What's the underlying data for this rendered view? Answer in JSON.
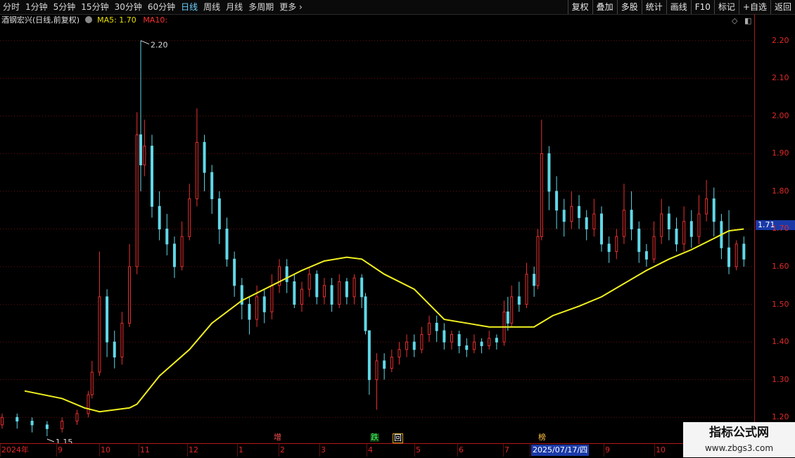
{
  "toolbar": {
    "periods": [
      "分时",
      "1分钟",
      "5分钟",
      "15分钟",
      "30分钟",
      "60分钟",
      "日线",
      "周线",
      "月线",
      "多周期",
      "更多"
    ],
    "active_period": "日线",
    "right_buttons": [
      "复权",
      "叠加",
      "多股",
      "统计",
      "画线",
      "F10",
      "标记",
      "+自选",
      "返回"
    ]
  },
  "info": {
    "stock": "酒钢宏兴(日线,前复权)",
    "ma5": "MA5: 1.70",
    "ma10": "MA10:"
  },
  "price_axis": {
    "labels": [
      "2.20",
      "2.10",
      "2.00",
      "1.90",
      "1.80",
      "1.70",
      "1.60",
      "1.50",
      "1.40",
      "1.30",
      "1.20"
    ],
    "current": "1.71"
  },
  "date_axis": {
    "labels": [
      "2024年",
      "9",
      "10",
      "11",
      "12",
      "1",
      "2",
      "3",
      "4",
      "5",
      "6",
      "7",
      "2025/07/17/四",
      "9",
      "10"
    ]
  },
  "markers": [
    "增",
    "跌",
    "回",
    "榜"
  ],
  "annotations": {
    "high": "2.20",
    "low": "1.15"
  },
  "watermark": {
    "line1": "指标公式网",
    "line2": "www.zbgs3.com"
  },
  "chart_data": {
    "type": "candlestick",
    "ylim": [
      1.15,
      2.22
    ],
    "grid": true,
    "colors": {
      "up": "#e83030",
      "down": "#60d8e8",
      "ma": "#f0f020",
      "grid": "#6a1010"
    },
    "ma_line": [
      [
        0.03,
        1.27
      ],
      [
        0.08,
        1.25
      ],
      [
        0.11,
        1.225
      ],
      [
        0.13,
        1.215
      ],
      [
        0.15,
        1.22
      ],
      [
        0.17,
        1.225
      ],
      [
        0.18,
        1.235
      ],
      [
        0.21,
        1.31
      ],
      [
        0.25,
        1.38
      ],
      [
        0.28,
        1.45
      ],
      [
        0.32,
        1.51
      ],
      [
        0.36,
        1.55
      ],
      [
        0.4,
        1.59
      ],
      [
        0.43,
        1.615
      ],
      [
        0.46,
        1.625
      ],
      [
        0.48,
        1.62
      ],
      [
        0.51,
        1.58
      ],
      [
        0.55,
        1.54
      ],
      [
        0.59,
        1.46
      ],
      [
        0.62,
        1.45
      ],
      [
        0.65,
        1.44
      ],
      [
        0.68,
        1.44
      ],
      [
        0.71,
        1.44
      ],
      [
        0.735,
        1.47
      ],
      [
        0.77,
        1.495
      ],
      [
        0.8,
        1.52
      ],
      [
        0.83,
        1.555
      ],
      [
        0.86,
        1.59
      ],
      [
        0.89,
        1.62
      ],
      [
        0.92,
        1.645
      ],
      [
        0.95,
        1.675
      ],
      [
        0.97,
        1.695
      ],
      [
        0.99,
        1.7
      ]
    ],
    "candles": [
      [
        0.0,
        1.18,
        1.2,
        1.21,
        1.17
      ],
      [
        0.02,
        1.2,
        1.19,
        1.21,
        1.17
      ],
      [
        0.04,
        1.19,
        1.18,
        1.2,
        1.16
      ],
      [
        0.06,
        1.18,
        1.17,
        1.19,
        1.15
      ],
      [
        0.08,
        1.17,
        1.19,
        1.2,
        1.16
      ],
      [
        0.1,
        1.19,
        1.21,
        1.22,
        1.18
      ],
      [
        0.115,
        1.21,
        1.26,
        1.27,
        1.2
      ],
      [
        0.12,
        1.26,
        1.32,
        1.35,
        1.25
      ],
      [
        0.13,
        1.32,
        1.52,
        1.64,
        1.31
      ],
      [
        0.14,
        1.52,
        1.4,
        1.54,
        1.36
      ],
      [
        0.15,
        1.4,
        1.36,
        1.43,
        1.33
      ],
      [
        0.16,
        1.36,
        1.45,
        1.48,
        1.34
      ],
      [
        0.17,
        1.45,
        1.6,
        1.66,
        1.44
      ],
      [
        0.18,
        1.6,
        1.95,
        2.01,
        1.58
      ],
      [
        0.185,
        1.95,
        1.87,
        2.2,
        1.8
      ],
      [
        0.19,
        1.87,
        1.92,
        1.99,
        1.84
      ],
      [
        0.2,
        1.92,
        1.76,
        1.95,
        1.73
      ],
      [
        0.21,
        1.76,
        1.7,
        1.8,
        1.67
      ],
      [
        0.22,
        1.7,
        1.66,
        1.74,
        1.63
      ],
      [
        0.23,
        1.66,
        1.6,
        1.68,
        1.57
      ],
      [
        0.24,
        1.6,
        1.68,
        1.72,
        1.59
      ],
      [
        0.25,
        1.68,
        1.78,
        1.82,
        1.67
      ],
      [
        0.26,
        1.78,
        1.93,
        2.02,
        1.76
      ],
      [
        0.27,
        1.93,
        1.85,
        1.95,
        1.8
      ],
      [
        0.28,
        1.85,
        1.78,
        1.87,
        1.74
      ],
      [
        0.29,
        1.78,
        1.7,
        1.8,
        1.66
      ],
      [
        0.3,
        1.7,
        1.62,
        1.73,
        1.6
      ],
      [
        0.31,
        1.62,
        1.55,
        1.64,
        1.52
      ],
      [
        0.32,
        1.55,
        1.5,
        1.57,
        1.46
      ],
      [
        0.33,
        1.5,
        1.46,
        1.52,
        1.42
      ],
      [
        0.34,
        1.46,
        1.52,
        1.55,
        1.44
      ],
      [
        0.35,
        1.52,
        1.48,
        1.54,
        1.45
      ],
      [
        0.36,
        1.48,
        1.55,
        1.58,
        1.46
      ],
      [
        0.37,
        1.55,
        1.6,
        1.62,
        1.53
      ],
      [
        0.38,
        1.6,
        1.56,
        1.62,
        1.53
      ],
      [
        0.39,
        1.56,
        1.5,
        1.58,
        1.49
      ],
      [
        0.4,
        1.5,
        1.54,
        1.56,
        1.48
      ],
      [
        0.41,
        1.54,
        1.58,
        1.6,
        1.52
      ],
      [
        0.42,
        1.58,
        1.52,
        1.59,
        1.5
      ],
      [
        0.43,
        1.52,
        1.55,
        1.57,
        1.5
      ],
      [
        0.44,
        1.55,
        1.5,
        1.57,
        1.48
      ],
      [
        0.45,
        1.5,
        1.56,
        1.58,
        1.49
      ],
      [
        0.46,
        1.56,
        1.52,
        1.57,
        1.5
      ],
      [
        0.47,
        1.52,
        1.57,
        1.58,
        1.5
      ],
      [
        0.48,
        1.57,
        1.52,
        1.58,
        1.49
      ],
      [
        0.485,
        1.52,
        1.43,
        1.53,
        1.42
      ],
      [
        0.49,
        1.43,
        1.3,
        1.38,
        1.26
      ],
      [
        0.5,
        1.3,
        1.35,
        1.37,
        1.22
      ],
      [
        0.51,
        1.35,
        1.33,
        1.37,
        1.3
      ],
      [
        0.52,
        1.33,
        1.36,
        1.38,
        1.32
      ],
      [
        0.53,
        1.36,
        1.38,
        1.4,
        1.34
      ],
      [
        0.54,
        1.38,
        1.4,
        1.42,
        1.36
      ],
      [
        0.55,
        1.4,
        1.38,
        1.42,
        1.36
      ],
      [
        0.56,
        1.38,
        1.42,
        1.44,
        1.37
      ],
      [
        0.57,
        1.42,
        1.45,
        1.47,
        1.4
      ],
      [
        0.58,
        1.45,
        1.43,
        1.47,
        1.4
      ],
      [
        0.59,
        1.43,
        1.4,
        1.45,
        1.38
      ],
      [
        0.6,
        1.4,
        1.42,
        1.43,
        1.38
      ],
      [
        0.61,
        1.42,
        1.39,
        1.43,
        1.37
      ],
      [
        0.62,
        1.39,
        1.38,
        1.41,
        1.36
      ],
      [
        0.63,
        1.38,
        1.4,
        1.42,
        1.37
      ],
      [
        0.64,
        1.4,
        1.39,
        1.41,
        1.37
      ],
      [
        0.65,
        1.39,
        1.41,
        1.43,
        1.38
      ],
      [
        0.66,
        1.41,
        1.4,
        1.42,
        1.38
      ],
      [
        0.67,
        1.4,
        1.48,
        1.51,
        1.39
      ],
      [
        0.675,
        1.48,
        1.45,
        1.52,
        1.43
      ],
      [
        0.68,
        1.45,
        1.52,
        1.55,
        1.44
      ],
      [
        0.69,
        1.52,
        1.5,
        1.56,
        1.48
      ],
      [
        0.7,
        1.5,
        1.58,
        1.61,
        1.49
      ],
      [
        0.71,
        1.58,
        1.55,
        1.6,
        1.52
      ],
      [
        0.715,
        1.55,
        1.68,
        1.7,
        1.54
      ],
      [
        0.72,
        1.68,
        1.9,
        1.99,
        1.67
      ],
      [
        0.73,
        1.9,
        1.8,
        1.92,
        1.75
      ],
      [
        0.74,
        1.8,
        1.75,
        1.84,
        1.7
      ],
      [
        0.75,
        1.75,
        1.72,
        1.78,
        1.68
      ],
      [
        0.76,
        1.72,
        1.76,
        1.8,
        1.7
      ],
      [
        0.77,
        1.76,
        1.73,
        1.79,
        1.7
      ],
      [
        0.78,
        1.73,
        1.7,
        1.75,
        1.67
      ],
      [
        0.79,
        1.7,
        1.74,
        1.78,
        1.68
      ],
      [
        0.8,
        1.74,
        1.66,
        1.76,
        1.64
      ],
      [
        0.81,
        1.66,
        1.64,
        1.68,
        1.61
      ],
      [
        0.82,
        1.64,
        1.68,
        1.7,
        1.62
      ],
      [
        0.83,
        1.68,
        1.75,
        1.82,
        1.66
      ],
      [
        0.84,
        1.75,
        1.7,
        1.8,
        1.67
      ],
      [
        0.85,
        1.7,
        1.64,
        1.72,
        1.61
      ],
      [
        0.86,
        1.64,
        1.62,
        1.66,
        1.6
      ],
      [
        0.87,
        1.62,
        1.68,
        1.72,
        1.61
      ],
      [
        0.88,
        1.68,
        1.74,
        1.78,
        1.66
      ],
      [
        0.89,
        1.74,
        1.7,
        1.76,
        1.67
      ],
      [
        0.9,
        1.7,
        1.66,
        1.73,
        1.64
      ],
      [
        0.91,
        1.66,
        1.72,
        1.76,
        1.64
      ],
      [
        0.92,
        1.72,
        1.68,
        1.75,
        1.65
      ],
      [
        0.93,
        1.68,
        1.74,
        1.79,
        1.66
      ],
      [
        0.94,
        1.74,
        1.78,
        1.83,
        1.72
      ],
      [
        0.95,
        1.78,
        1.72,
        1.81,
        1.68
      ],
      [
        0.96,
        1.72,
        1.65,
        1.74,
        1.62
      ],
      [
        0.97,
        1.65,
        1.6,
        1.75,
        1.58
      ],
      [
        0.98,
        1.6,
        1.66,
        1.67,
        1.59
      ],
      [
        0.99,
        1.66,
        1.62,
        1.68,
        1.6
      ]
    ]
  }
}
